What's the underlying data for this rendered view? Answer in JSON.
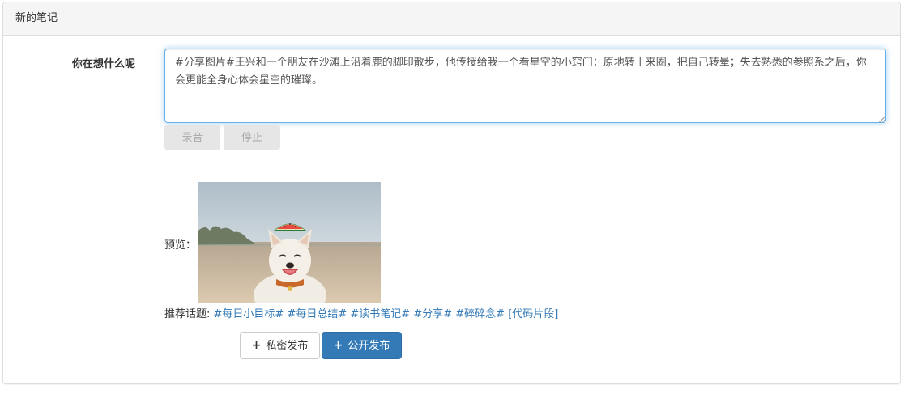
{
  "panel": {
    "title": "新的笔记"
  },
  "form": {
    "label": "你在想什么呢",
    "textarea_value": "#分享图片#王兴和一个朋友在沙滩上沿着鹿的脚印散步，他传授给我一个看星空的小窍门：原地转十来圈，把自己转晕；失去熟悉的参照系之后，你会更能全身心体会星空的璀璨。",
    "record_label": "录音",
    "stop_label": "停止"
  },
  "preview": {
    "label": "预览："
  },
  "topics": {
    "label": "推荐话题:",
    "items": [
      "#每日小目标#",
      "#每日总结#",
      "#读书笔记#",
      "#分享#",
      "#碎碎念#",
      "[代码片段]"
    ]
  },
  "actions": {
    "private_label": "私密发布",
    "public_label": "公开发布",
    "plus_icon": "+"
  },
  "colors": {
    "link": "#337ab7",
    "primary": "#337ab7",
    "focus_border": "#66afe9"
  }
}
